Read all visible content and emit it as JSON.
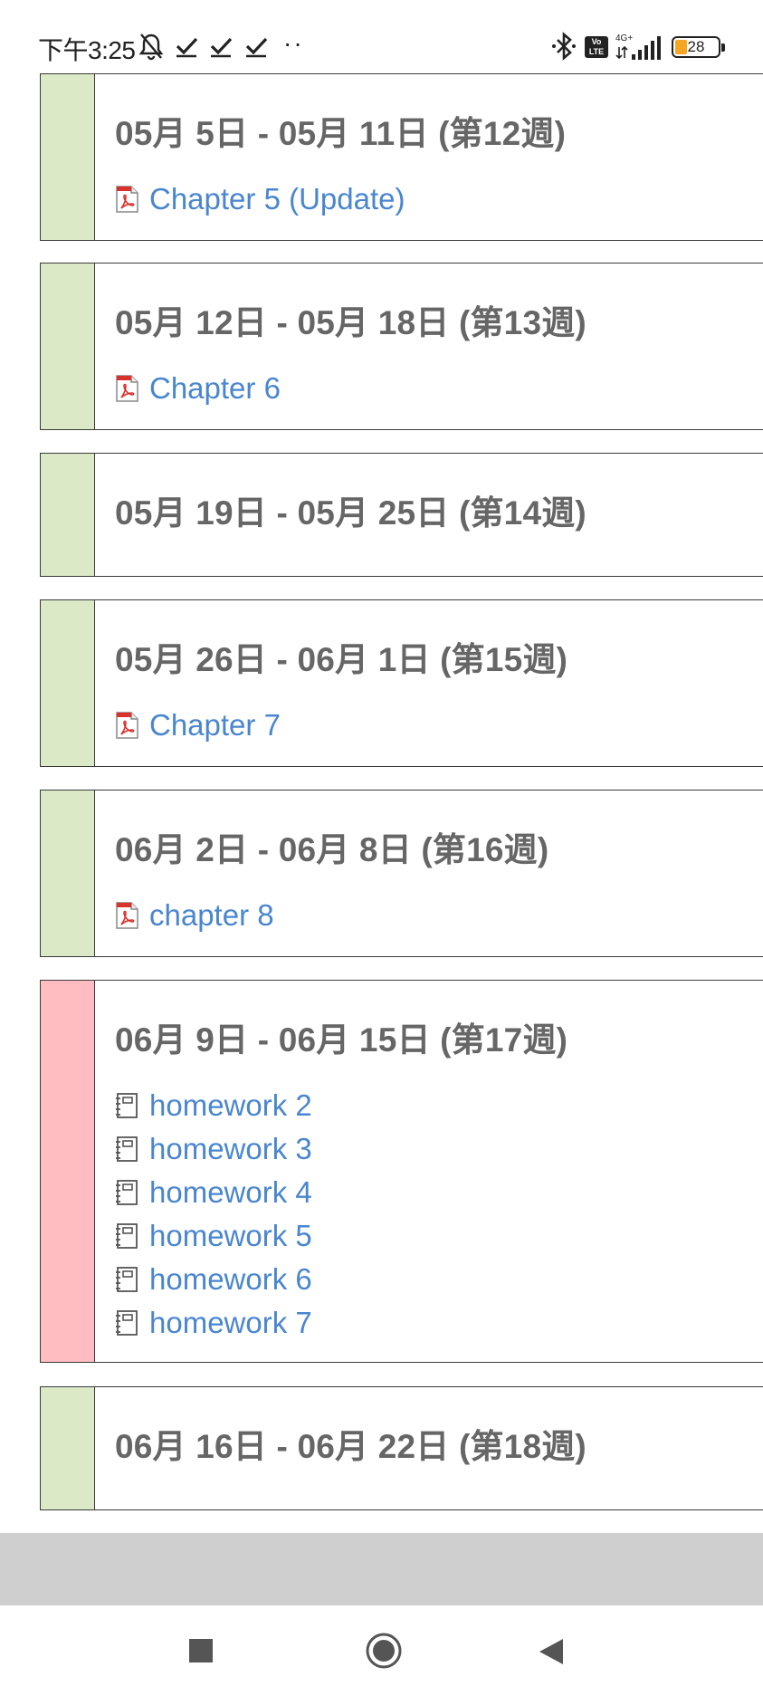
{
  "status_bar": {
    "time": "下午3:25",
    "extra": "··",
    "volte": "Vo LTE",
    "network": "4G+",
    "battery": "28",
    "battery_level": 0.28,
    "icons": [
      "bell-muted-icon",
      "check-icon",
      "check-icon",
      "check-icon",
      "bluetooth-icon",
      "volte-icon",
      "signal-icon",
      "battery-icon"
    ]
  },
  "colors": {
    "done": "#dbe9c6",
    "current": "#ffbdc1",
    "link": "#4a86cf",
    "title": "#666666"
  },
  "sections": [
    {
      "title": "05月 5日 - 05月 11日 (第12週)",
      "state": "done",
      "activities": [
        {
          "icon": "pdf-icon",
          "label": "Chapter 5 (Update)"
        }
      ]
    },
    {
      "title": "05月 12日 - 05月 18日 (第13週)",
      "state": "done",
      "activities": [
        {
          "icon": "pdf-icon",
          "label": "Chapter 6"
        }
      ]
    },
    {
      "title": "05月 19日 - 05月 25日 (第14週)",
      "state": "done",
      "activities": []
    },
    {
      "title": "05月 26日 - 06月 1日 (第15週)",
      "state": "done",
      "activities": [
        {
          "icon": "pdf-icon",
          "label": "Chapter 7"
        }
      ]
    },
    {
      "title": "06月 2日 - 06月 8日 (第16週)",
      "state": "done",
      "activities": [
        {
          "icon": "pdf-icon",
          "label": "chapter 8"
        }
      ]
    },
    {
      "title": "06月 9日 - 06月 15日 (第17週)",
      "state": "current",
      "activities": [
        {
          "icon": "assignment-icon",
          "label": "homework 2"
        },
        {
          "icon": "assignment-icon",
          "label": "homework 3"
        },
        {
          "icon": "assignment-icon",
          "label": "homework 4"
        },
        {
          "icon": "assignment-icon",
          "label": "homework 5"
        },
        {
          "icon": "assignment-icon",
          "label": "homework 6"
        },
        {
          "icon": "assignment-icon",
          "label": "homework 7"
        }
      ]
    },
    {
      "title": "06月 16日 - 06月 22日 (第18週)",
      "state": "done",
      "activities": []
    }
  ],
  "nav": {
    "buttons": [
      "recents-button",
      "home-button",
      "back-button"
    ]
  }
}
